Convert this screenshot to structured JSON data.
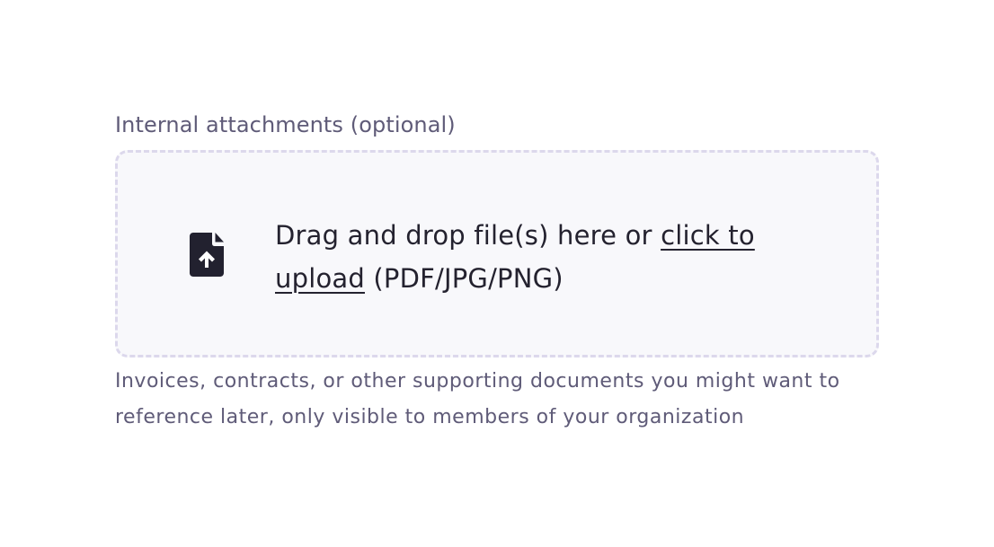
{
  "field": {
    "label": "Internal attachments (optional)",
    "dropzone": {
      "icon": "file-upload-icon",
      "text_before_link": "Drag and drop file(s) here or ",
      "link_label": "click to upload",
      "text_after_link": " (PDF/JPG/PNG)"
    },
    "help_text": "Invoices, contracts, or other supporting documents you might want to reference later, only visible to members of your organization"
  },
  "colors": {
    "label_text": "#5f5b78",
    "body_text": "#24222f",
    "dropzone_border": "#dcd8ec",
    "dropzone_background": "#f8f8fb",
    "icon_fill": "#22212f"
  }
}
